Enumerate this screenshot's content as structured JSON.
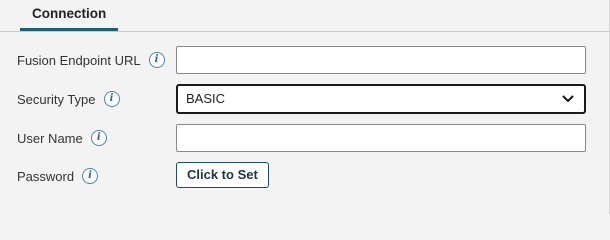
{
  "tabs": [
    {
      "label": "Connection",
      "active": true
    }
  ],
  "form": {
    "fusion_url": {
      "label": "Fusion Endpoint URL",
      "value": "",
      "placeholder": ""
    },
    "security_type": {
      "label": "Security Type",
      "value": "BASIC"
    },
    "user_name": {
      "label": "User Name",
      "value": "",
      "placeholder": ""
    },
    "password": {
      "label": "Password",
      "button_label": "Click to Set"
    }
  },
  "icons": {
    "info": "info-icon",
    "chevron": "chevron-down-icon"
  },
  "colors": {
    "accent": "#1f5e73",
    "info_icon": "#2b6a90",
    "background": "#f3f3f3"
  }
}
